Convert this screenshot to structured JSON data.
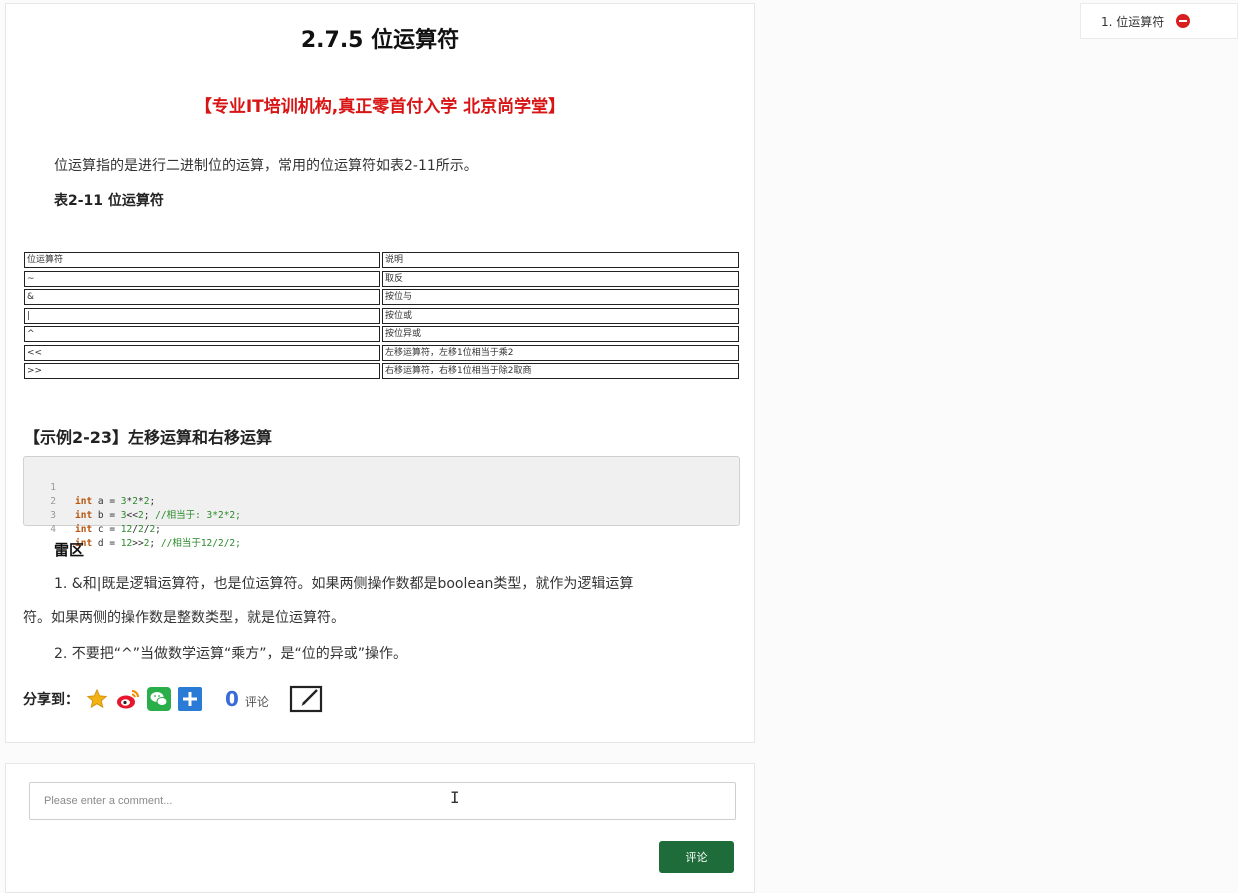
{
  "article": {
    "title": "2.7.5 位运算符",
    "promo": "【专业IT培训机构,真正零首付入学 北京尚学堂】",
    "intro": "位运算指的是进行二进制位的运算，常用的位运算符如表2-11所示。",
    "table_caption": "表2-11 位运算符",
    "table_rows": [
      [
        "位运算符",
        "说明"
      ],
      [
        "~",
        "取反"
      ],
      [
        "&",
        "按位与"
      ],
      [
        "|",
        "按位或"
      ],
      [
        "^",
        "按位异或"
      ],
      [
        "<<",
        "左移运算符，左移1位相当于乘2"
      ],
      [
        ">>",
        "右移运算符，右移1位相当于除2取商"
      ]
    ],
    "example_title": "【示例2-23】左移运算和右移运算",
    "code": {
      "line_numbers": [
        "1",
        "2",
        "3",
        "4"
      ]
    },
    "warn_title": "雷区",
    "para1_line1": "1. &和|既是逻辑运算符，也是位运算符。如果两侧操作数都是boolean类型，就作为逻辑运算",
    "para1_line2": "符。如果两侧的操作数是整数类型，就是位运算符。",
    "para2": "2. 不要把“^”当做数学运算“乘方”，是“位的异或”操作。"
  },
  "share": {
    "label": "分享到：",
    "icons": [
      "qzone-star-icon",
      "weibo-icon",
      "wechat-icon",
      "plus-share-icon"
    ],
    "comment_count": "0",
    "comment_count_label": "评论"
  },
  "comment": {
    "placeholder": "Please enter a comment...",
    "submit_label": "评论",
    "button_color": "#1d6c3a"
  },
  "toc": {
    "item_label": "1. 位运算符"
  },
  "colors": {
    "promo": "#d81414",
    "count": "#3a6bd8"
  }
}
